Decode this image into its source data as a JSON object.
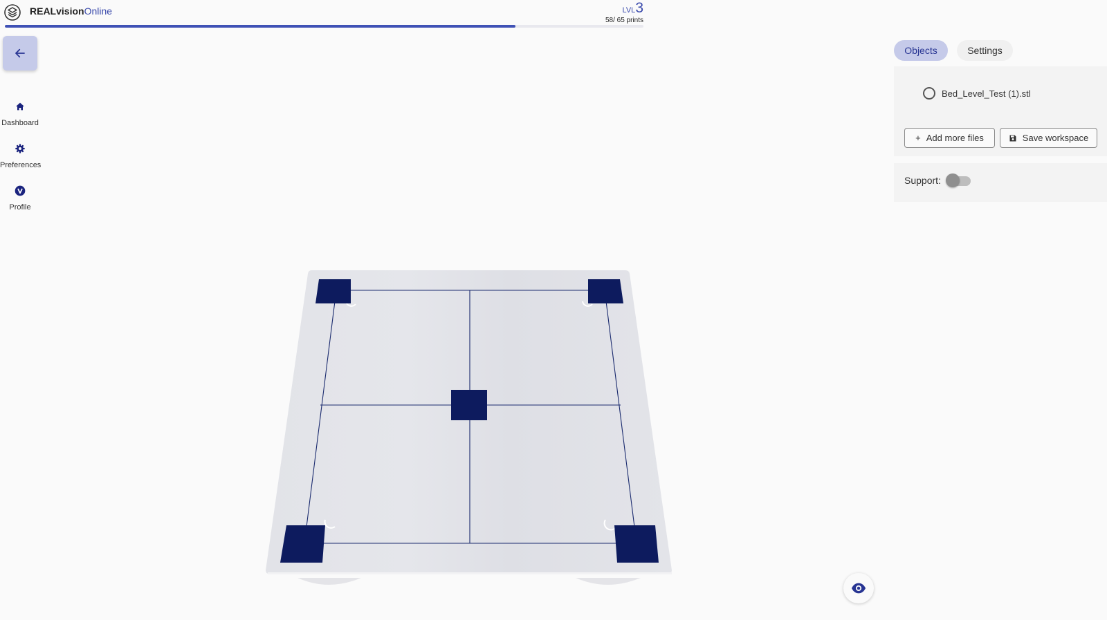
{
  "app": {
    "brand_bold": "REALvision",
    "brand_light": "Online",
    "logo_icon": "layers-icon"
  },
  "level": {
    "prefix": "LVL",
    "number": "3",
    "prints_text": "58/ 65 prints",
    "progress_fraction": 0.8
  },
  "nav": {
    "back_icon": "arrow-left-icon",
    "items": [
      {
        "label": "Dashboard",
        "icon": "home-icon"
      },
      {
        "label": "Preferences",
        "icon": "gear-icon"
      },
      {
        "label": "Profile",
        "icon": "profile-v-icon"
      }
    ]
  },
  "panel": {
    "tabs": [
      {
        "label": "Objects",
        "active": true
      },
      {
        "label": "Settings",
        "active": false
      }
    ],
    "file_name": "Bed_Level_Test (1).stl",
    "add_files_label": "Add more files",
    "save_workspace_label": "Save workspace",
    "support_label": "Support:",
    "support_enabled": false
  },
  "colors": {
    "accent": "#3f51b5",
    "accent_light": "#c5cae9",
    "model_blue": "#0d1b5e",
    "bed_gray": "#e2e3e8"
  }
}
